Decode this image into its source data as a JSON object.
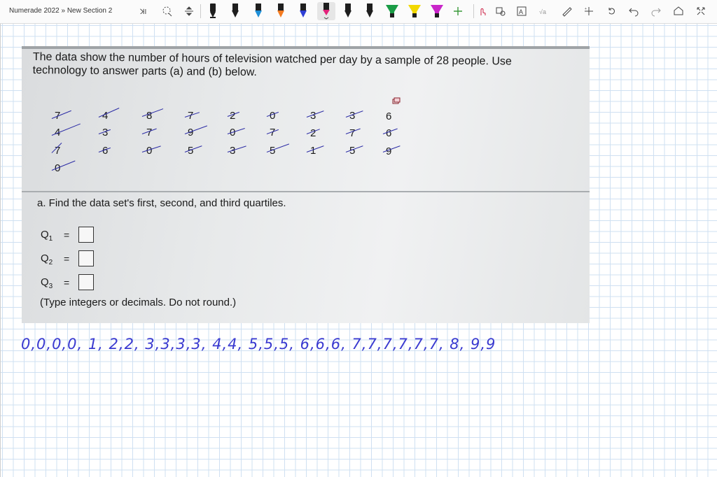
{
  "notebook": {
    "breadcrumb": "Numerade 2022 » New Section 2"
  },
  "toolbar": {
    "colors": {
      "pen1": "#1e1e1e",
      "pen2": "#1e1e1e",
      "pen3": "#1e8fd8",
      "pen4": "#f47b20",
      "pen5": "#2f3fd6",
      "pen6": "#e2227a",
      "pen7": "#1e1e1e",
      "pen8": "#1a9c46",
      "pen9": "#f2d800",
      "pen10": "#c926c9"
    },
    "icons": [
      "lasso-text-icon",
      "lasso-select-icon",
      "insert-space-icon",
      "add-pen-icon",
      "touch-writing-icon",
      "ink-to-shape-icon",
      "ink-to-text-icon",
      "ink-to-math-icon",
      "ruler-icon",
      "math-icon",
      "replay-icon",
      "undo-icon",
      "redo-icon",
      "immersive-reader-icon",
      "fullscreen-icon"
    ]
  },
  "question": {
    "intro": "The data show the number of hours of television watched per day by a sample of 28 people. Use technology to answer parts (a) and (b) below.",
    "rows": [
      [
        "7",
        "4",
        "8",
        "7",
        "2",
        "0",
        "3",
        "3",
        "6"
      ],
      [
        "4",
        "3",
        "7",
        "9",
        "0",
        "7",
        "2",
        "7",
        "6"
      ],
      [
        "7",
        "6",
        "0",
        "5",
        "3",
        "5",
        "1",
        "5",
        "9"
      ],
      [
        "0"
      ]
    ],
    "part_a": "a. Find the data set's first, second, and third quartiles.",
    "q1_label": "Q",
    "q1_sub": "1",
    "q2_label": "Q",
    "q2_sub": "2",
    "q3_label": "Q",
    "q3_sub": "3",
    "equals": "=",
    "note": "(Type integers or decimals. Do not round.)"
  },
  "handwritten": {
    "sorted_list": "0,0,0,0, 1, 2,2, 3,3,3,3, 4,4, 5,5,5, 6,6,6, 7,7,7,7,7,7, 8, 9,9",
    "color": "#3a3ad0"
  }
}
